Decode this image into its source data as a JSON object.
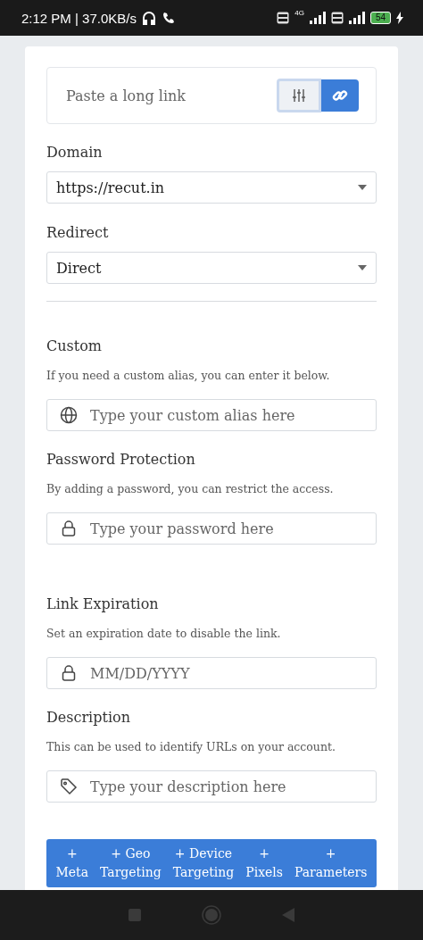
{
  "status_bar": {
    "time": "2:12 PM | 37.0KB/s",
    "network": "4G",
    "battery": "54"
  },
  "link_box": {
    "placeholder": "Paste a long link"
  },
  "selects": [
    {
      "label": "Domain",
      "value": "https://recut.in"
    },
    {
      "label": "Redirect",
      "value": "Direct"
    }
  ],
  "sections": [
    {
      "title": "Custom",
      "help": "If you need a custom alias, you can enter it below.",
      "placeholder": "Type your custom alias here",
      "kind": "globe"
    },
    {
      "title": "Password Protection",
      "help": "By adding a password, you can restrict the access.",
      "placeholder": "Type your password here",
      "kind": "lock"
    },
    {
      "title": "Link Expiration",
      "help": "Set an expiration date to disable the link.",
      "placeholder": "MM/DD/YYYY",
      "kind": "lock"
    },
    {
      "title": "Description",
      "help": "This can be used to identify URLs on your account.",
      "placeholder": "Type your description here",
      "kind": "tag"
    }
  ],
  "option_tabs": [
    "+ Meta",
    "+ Geo Targeting",
    "+ Device Targeting",
    "+ Pixels",
    "+ Parameters"
  ]
}
